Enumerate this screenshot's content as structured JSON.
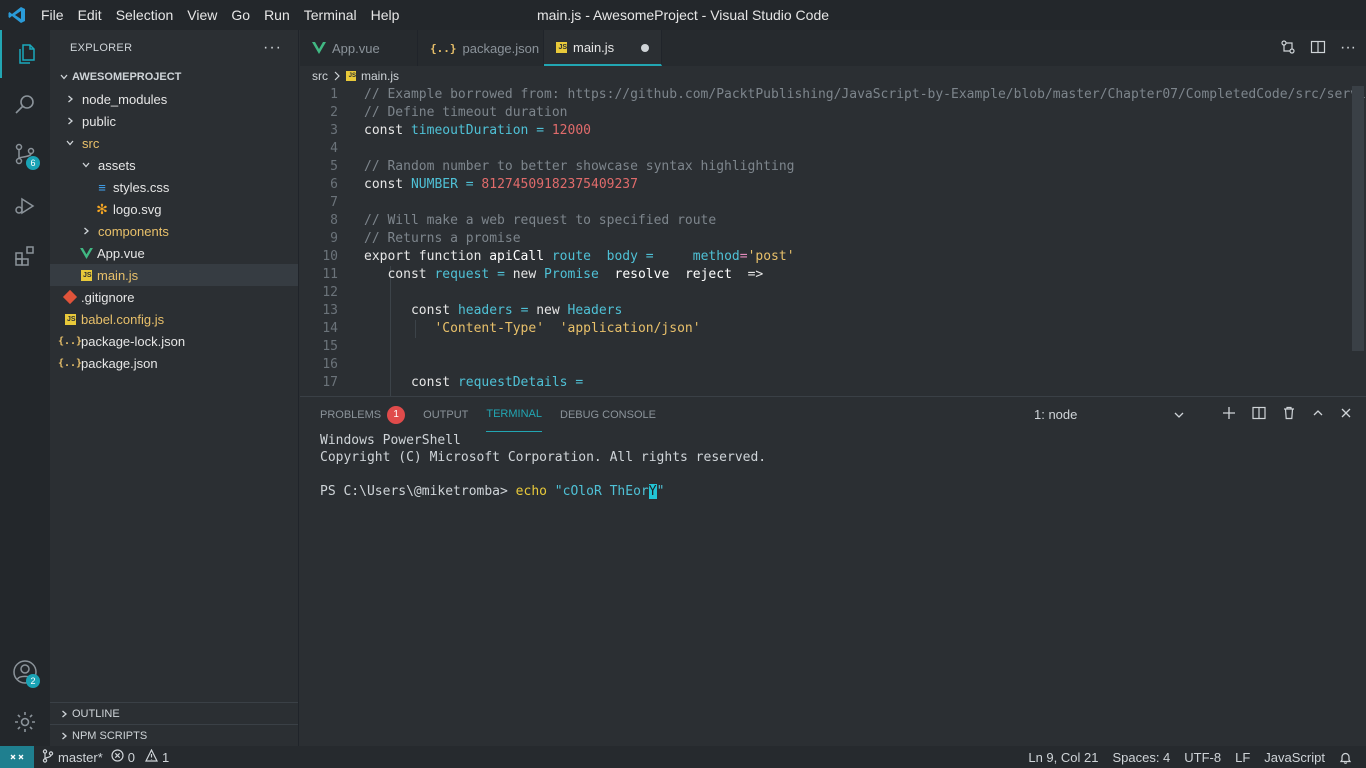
{
  "window": {
    "title": "main.js - AwesomeProject - Visual Studio Code"
  },
  "menu": [
    "File",
    "Edit",
    "Selection",
    "View",
    "Go",
    "Run",
    "Terminal",
    "Help"
  ],
  "activity": {
    "scm_badge": "6",
    "account_badge": "2"
  },
  "explorer": {
    "header": "EXPLORER",
    "project": "AWESOMEPROJECT",
    "tree": [
      {
        "label": "node_modules",
        "type": "folder",
        "open": false,
        "depth": 0
      },
      {
        "label": "public",
        "type": "folder",
        "open": false,
        "depth": 0
      },
      {
        "label": "src",
        "type": "folder",
        "open": true,
        "depth": 0
      },
      {
        "label": "assets",
        "type": "folder",
        "open": true,
        "depth": 1
      },
      {
        "label": "styles.css",
        "type": "css",
        "depth": 2
      },
      {
        "label": "logo.svg",
        "type": "svg",
        "depth": 2
      },
      {
        "label": "components",
        "type": "folder",
        "open": false,
        "depth": 1
      },
      {
        "label": "App.vue",
        "type": "vue",
        "depth": 1
      },
      {
        "label": "main.js",
        "type": "js",
        "depth": 1,
        "selected": true
      },
      {
        "label": ".gitignore",
        "type": "git",
        "depth": 0
      },
      {
        "label": "babel.config.js",
        "type": "js",
        "depth": 0
      },
      {
        "label": "package-lock.json",
        "type": "json",
        "depth": 0
      },
      {
        "label": "package.json",
        "type": "json",
        "depth": 0
      }
    ],
    "outline": "OUTLINE",
    "npm_scripts": "NPM SCRIPTS"
  },
  "tabs": [
    {
      "label": "App.vue",
      "icon": "vue",
      "active": false
    },
    {
      "label": "package.json",
      "icon": "json",
      "active": false
    },
    {
      "label": "main.js",
      "icon": "js",
      "active": true,
      "dirty": true
    }
  ],
  "breadcrumb": {
    "folder": "src",
    "file": "main.js"
  },
  "editor": {
    "line_numbers": [
      "1",
      "2",
      "3",
      "4",
      "5",
      "6",
      "7",
      "8",
      "9",
      "10",
      "11",
      "12",
      "13",
      "14",
      "15",
      "16",
      "17"
    ]
  },
  "panel": {
    "tabs": {
      "problems": "PROBLEMS",
      "problems_count": "1",
      "output": "OUTPUT",
      "terminal": "TERMINAL",
      "debug": "DEBUG CONSOLE"
    },
    "terminal_select": "1: node",
    "lines": {
      "l1": "Windows PowerShell",
      "l2": "Copyright (C) Microsoft Corporation. All rights reserved.",
      "prompt": "PS C:\\Users\\@miketromba> ",
      "cmd": "echo",
      "arg_before": " \"cOloR ThEor",
      "arg_cursor": "Y",
      "arg_after": "\""
    }
  },
  "status": {
    "branch": "master*",
    "errors": "0",
    "warnings": "1",
    "position": "Ln 9, Col 21",
    "spaces": "Spaces: 4",
    "encoding": "UTF-8",
    "eol": "LF",
    "language": "JavaScript"
  },
  "colors": {
    "accent": "#22a6b3",
    "error": "#e04b4b",
    "string": "#e8c06a",
    "variable": "#4fc1d6",
    "number": "#e06b6b"
  }
}
